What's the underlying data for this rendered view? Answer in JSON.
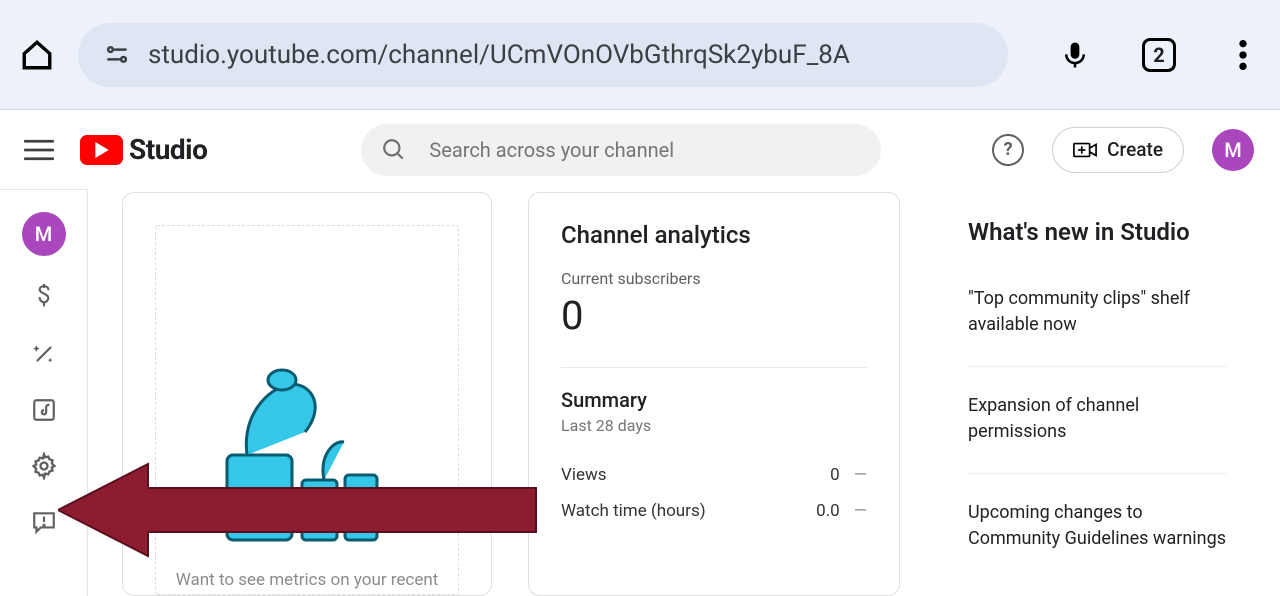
{
  "browser": {
    "url": "studio.youtube.com/channel/UCmVOnOVbGthrqSk2ybuF_8A",
    "tab_count": "2"
  },
  "header": {
    "logo_text": "Studio",
    "search_placeholder": "Search across your channel",
    "create_label": "Create",
    "avatar_letter": "M"
  },
  "sidebar": {
    "avatar_letter": "M"
  },
  "upload_card": {
    "prompt": "Want to see metrics on your recent"
  },
  "analytics": {
    "title": "Channel analytics",
    "subs_label": "Current subscribers",
    "subs_value": "0",
    "summary_title": "Summary",
    "summary_sub": "Last 28 days",
    "rows": [
      {
        "label": "Views",
        "value": "0",
        "delta": "—"
      },
      {
        "label": "Watch time (hours)",
        "value": "0.0",
        "delta": "—"
      }
    ]
  },
  "news": {
    "title": "What's new in Studio",
    "items": [
      "\"Top community clips\" shelf available now",
      "Expansion of channel permissions",
      "Upcoming changes to Community Guidelines warnings"
    ]
  }
}
